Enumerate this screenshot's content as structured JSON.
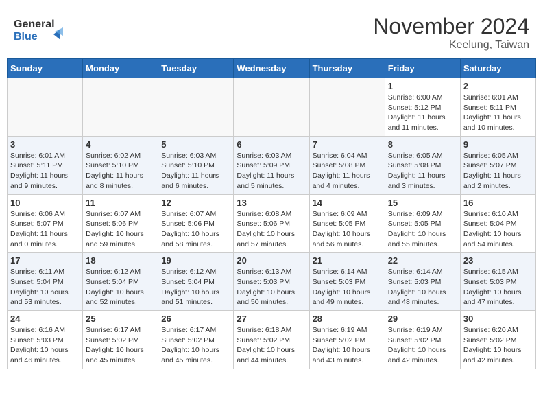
{
  "header": {
    "logo_line1": "General",
    "logo_line2": "Blue",
    "month_title": "November 2024",
    "location": "Keelung, Taiwan"
  },
  "days_of_week": [
    "Sunday",
    "Monday",
    "Tuesday",
    "Wednesday",
    "Thursday",
    "Friday",
    "Saturday"
  ],
  "weeks": [
    [
      {
        "day": "",
        "info": ""
      },
      {
        "day": "",
        "info": ""
      },
      {
        "day": "",
        "info": ""
      },
      {
        "day": "",
        "info": ""
      },
      {
        "day": "",
        "info": ""
      },
      {
        "day": "1",
        "info": "Sunrise: 6:00 AM\nSunset: 5:12 PM\nDaylight: 11 hours\nand 11 minutes."
      },
      {
        "day": "2",
        "info": "Sunrise: 6:01 AM\nSunset: 5:11 PM\nDaylight: 11 hours\nand 10 minutes."
      }
    ],
    [
      {
        "day": "3",
        "info": "Sunrise: 6:01 AM\nSunset: 5:11 PM\nDaylight: 11 hours\nand 9 minutes."
      },
      {
        "day": "4",
        "info": "Sunrise: 6:02 AM\nSunset: 5:10 PM\nDaylight: 11 hours\nand 8 minutes."
      },
      {
        "day": "5",
        "info": "Sunrise: 6:03 AM\nSunset: 5:10 PM\nDaylight: 11 hours\nand 6 minutes."
      },
      {
        "day": "6",
        "info": "Sunrise: 6:03 AM\nSunset: 5:09 PM\nDaylight: 11 hours\nand 5 minutes."
      },
      {
        "day": "7",
        "info": "Sunrise: 6:04 AM\nSunset: 5:08 PM\nDaylight: 11 hours\nand 4 minutes."
      },
      {
        "day": "8",
        "info": "Sunrise: 6:05 AM\nSunset: 5:08 PM\nDaylight: 11 hours\nand 3 minutes."
      },
      {
        "day": "9",
        "info": "Sunrise: 6:05 AM\nSunset: 5:07 PM\nDaylight: 11 hours\nand 2 minutes."
      }
    ],
    [
      {
        "day": "10",
        "info": "Sunrise: 6:06 AM\nSunset: 5:07 PM\nDaylight: 11 hours\nand 0 minutes."
      },
      {
        "day": "11",
        "info": "Sunrise: 6:07 AM\nSunset: 5:06 PM\nDaylight: 10 hours\nand 59 minutes."
      },
      {
        "day": "12",
        "info": "Sunrise: 6:07 AM\nSunset: 5:06 PM\nDaylight: 10 hours\nand 58 minutes."
      },
      {
        "day": "13",
        "info": "Sunrise: 6:08 AM\nSunset: 5:06 PM\nDaylight: 10 hours\nand 57 minutes."
      },
      {
        "day": "14",
        "info": "Sunrise: 6:09 AM\nSunset: 5:05 PM\nDaylight: 10 hours\nand 56 minutes."
      },
      {
        "day": "15",
        "info": "Sunrise: 6:09 AM\nSunset: 5:05 PM\nDaylight: 10 hours\nand 55 minutes."
      },
      {
        "day": "16",
        "info": "Sunrise: 6:10 AM\nSunset: 5:04 PM\nDaylight: 10 hours\nand 54 minutes."
      }
    ],
    [
      {
        "day": "17",
        "info": "Sunrise: 6:11 AM\nSunset: 5:04 PM\nDaylight: 10 hours\nand 53 minutes."
      },
      {
        "day": "18",
        "info": "Sunrise: 6:12 AM\nSunset: 5:04 PM\nDaylight: 10 hours\nand 52 minutes."
      },
      {
        "day": "19",
        "info": "Sunrise: 6:12 AM\nSunset: 5:04 PM\nDaylight: 10 hours\nand 51 minutes."
      },
      {
        "day": "20",
        "info": "Sunrise: 6:13 AM\nSunset: 5:03 PM\nDaylight: 10 hours\nand 50 minutes."
      },
      {
        "day": "21",
        "info": "Sunrise: 6:14 AM\nSunset: 5:03 PM\nDaylight: 10 hours\nand 49 minutes."
      },
      {
        "day": "22",
        "info": "Sunrise: 6:14 AM\nSunset: 5:03 PM\nDaylight: 10 hours\nand 48 minutes."
      },
      {
        "day": "23",
        "info": "Sunrise: 6:15 AM\nSunset: 5:03 PM\nDaylight: 10 hours\nand 47 minutes."
      }
    ],
    [
      {
        "day": "24",
        "info": "Sunrise: 6:16 AM\nSunset: 5:03 PM\nDaylight: 10 hours\nand 46 minutes."
      },
      {
        "day": "25",
        "info": "Sunrise: 6:17 AM\nSunset: 5:02 PM\nDaylight: 10 hours\nand 45 minutes."
      },
      {
        "day": "26",
        "info": "Sunrise: 6:17 AM\nSunset: 5:02 PM\nDaylight: 10 hours\nand 45 minutes."
      },
      {
        "day": "27",
        "info": "Sunrise: 6:18 AM\nSunset: 5:02 PM\nDaylight: 10 hours\nand 44 minutes."
      },
      {
        "day": "28",
        "info": "Sunrise: 6:19 AM\nSunset: 5:02 PM\nDaylight: 10 hours\nand 43 minutes."
      },
      {
        "day": "29",
        "info": "Sunrise: 6:19 AM\nSunset: 5:02 PM\nDaylight: 10 hours\nand 42 minutes."
      },
      {
        "day": "30",
        "info": "Sunrise: 6:20 AM\nSunset: 5:02 PM\nDaylight: 10 hours\nand 42 minutes."
      }
    ]
  ]
}
